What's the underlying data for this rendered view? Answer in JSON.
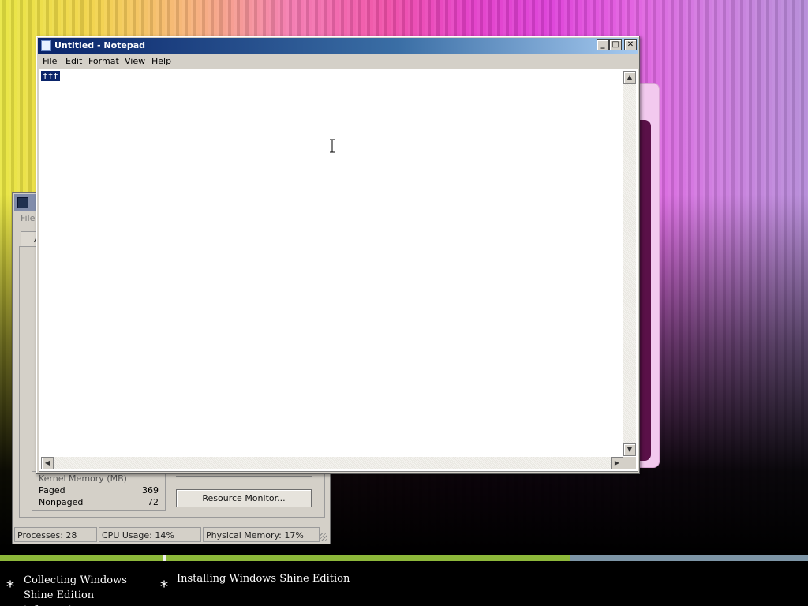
{
  "notepad": {
    "title": "Untitled - Notepad",
    "menu": [
      "File",
      "Edit",
      "Format",
      "View",
      "Help"
    ],
    "text_selected": "fff",
    "controls": {
      "minimize": "_",
      "maximize": "□",
      "close": "✕"
    }
  },
  "task_manager": {
    "menu_first": "File",
    "tab_partial": "Ap",
    "kernel_memory": {
      "title": "Kernel Memory (MB)",
      "paged_label": "Paged",
      "paged_value": "369",
      "nonpaged_label": "Nonpaged",
      "nonpaged_value": "72"
    },
    "resource_monitor_button": "Resource Monitor...",
    "status": {
      "processes": "Processes: 28",
      "cpu": "CPU Usage: 14%",
      "memory": "Physical Memory: 17%"
    }
  },
  "setup": {
    "step1": "Collecting Windows Shine Edition information",
    "step2": "Installing Windows Shine Edition",
    "bullet": "*"
  }
}
